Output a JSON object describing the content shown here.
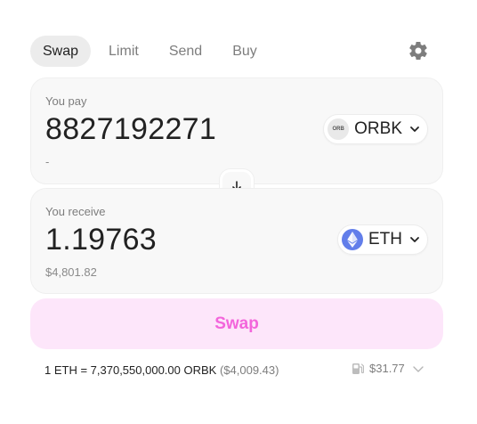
{
  "tabs": [
    {
      "label": "Swap",
      "active": true
    },
    {
      "label": "Limit",
      "active": false
    },
    {
      "label": "Send",
      "active": false
    },
    {
      "label": "Buy",
      "active": false
    }
  ],
  "pay": {
    "label": "You pay",
    "amount": "8827192271",
    "usd_value": "-",
    "token": {
      "logo_text": "ORB",
      "symbol": "ORBK"
    }
  },
  "receive": {
    "label": "You receive",
    "amount": "1.19763",
    "usd_value": "$4,801.82",
    "token": {
      "symbol": "ETH"
    }
  },
  "swap_button": {
    "label": "Swap"
  },
  "rate": {
    "text": "1 ETH = 7,370,550,000.00 ORBK",
    "usd": "($4,009.43)"
  },
  "gas": {
    "value": "$31.77"
  },
  "colors": {
    "accent": "#f365db",
    "swap_button_bg": "#fde6fa",
    "eth_logo": "#627eea",
    "panel_bg": "#f8f8f8"
  },
  "icons": {
    "settings": "gear-icon",
    "switch": "arrow-down-icon",
    "gas": "gas-pump-icon",
    "dropdown": "chevron-down-icon"
  }
}
